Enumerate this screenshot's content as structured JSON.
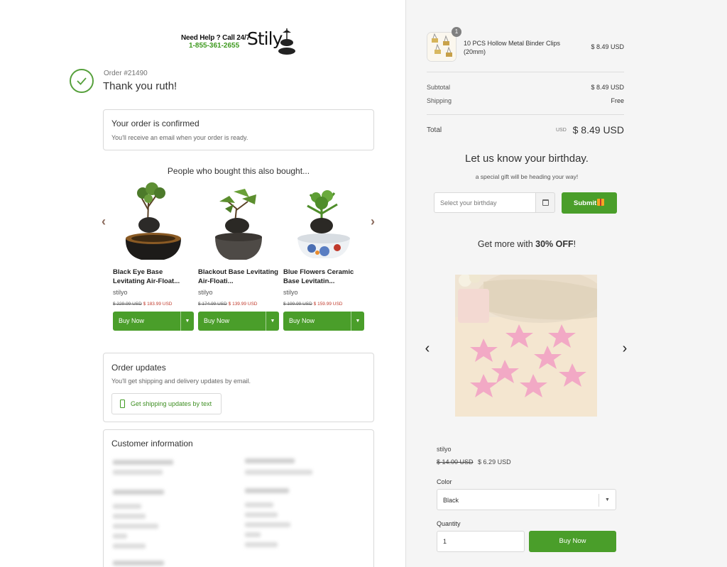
{
  "header": {
    "help_line_1": "Need Help ? Call 24/7",
    "help_line_2": "1-855-361-2655",
    "brand": "Stily"
  },
  "order": {
    "number": "Order #21490",
    "thanks": "Thank you ruth!"
  },
  "confirmation": {
    "title": "Your order is confirmed",
    "text": "You'll receive an email when your order is ready."
  },
  "recommendations": {
    "title": "People who bought this also bought...",
    "products": [
      {
        "name": "Black Eye Base Levitating Air-Float...",
        "vendor": "stilyo",
        "old_price": "$ 229.99 USD",
        "new_price": "$ 183.99 USD",
        "button": "Buy Now"
      },
      {
        "name": "Blackout Base Levitating Air-Floati...",
        "vendor": "stilyo",
        "old_price": "$ 174.99 USD",
        "new_price": "$ 139.99 USD",
        "button": "Buy Now"
      },
      {
        "name": "Blue Flowers Ceramic Base Levitatin...",
        "vendor": "stilyo",
        "old_price": "$ 199.99 USD",
        "new_price": "$ 159.99 USD",
        "button": "Buy Now"
      }
    ]
  },
  "updates": {
    "title": "Order updates",
    "text": "You'll get shipping and delivery updates by email.",
    "sms_button": "Get shipping updates by text"
  },
  "customer": {
    "title": "Customer information"
  },
  "summary": {
    "item_qty": "1",
    "item_name": "10 PCS Hollow Metal Binder Clips (20mm)",
    "item_price": "$ 8.49 USD",
    "subtotal_label": "Subtotal",
    "subtotal_value": "$ 8.49 USD",
    "shipping_label": "Shipping",
    "shipping_value": "Free",
    "total_label": "Total",
    "total_currency": "USD",
    "total_value": "$ 8.49 USD"
  },
  "birthday": {
    "title": "Let us know your birthday.",
    "subtitle": "a special gift will be heading your way!",
    "placeholder": "Select your birthday",
    "submit": "Submit"
  },
  "promo": {
    "prefix": "Get more with ",
    "highlight": "30% OFF",
    "suffix": "!",
    "vendor": "stilyo",
    "old_price": "$ 14.00 USD",
    "new_price": "$ 6.29 USD",
    "color_label": "Color",
    "color_value": "Black",
    "quantity_label": "Quantity",
    "quantity_value": "1",
    "buy_button": "Buy Now"
  },
  "colors": {
    "accent_green": "#4a9e2a",
    "sale_red": "#c0392b",
    "panel_bg": "#f5f5f5"
  }
}
